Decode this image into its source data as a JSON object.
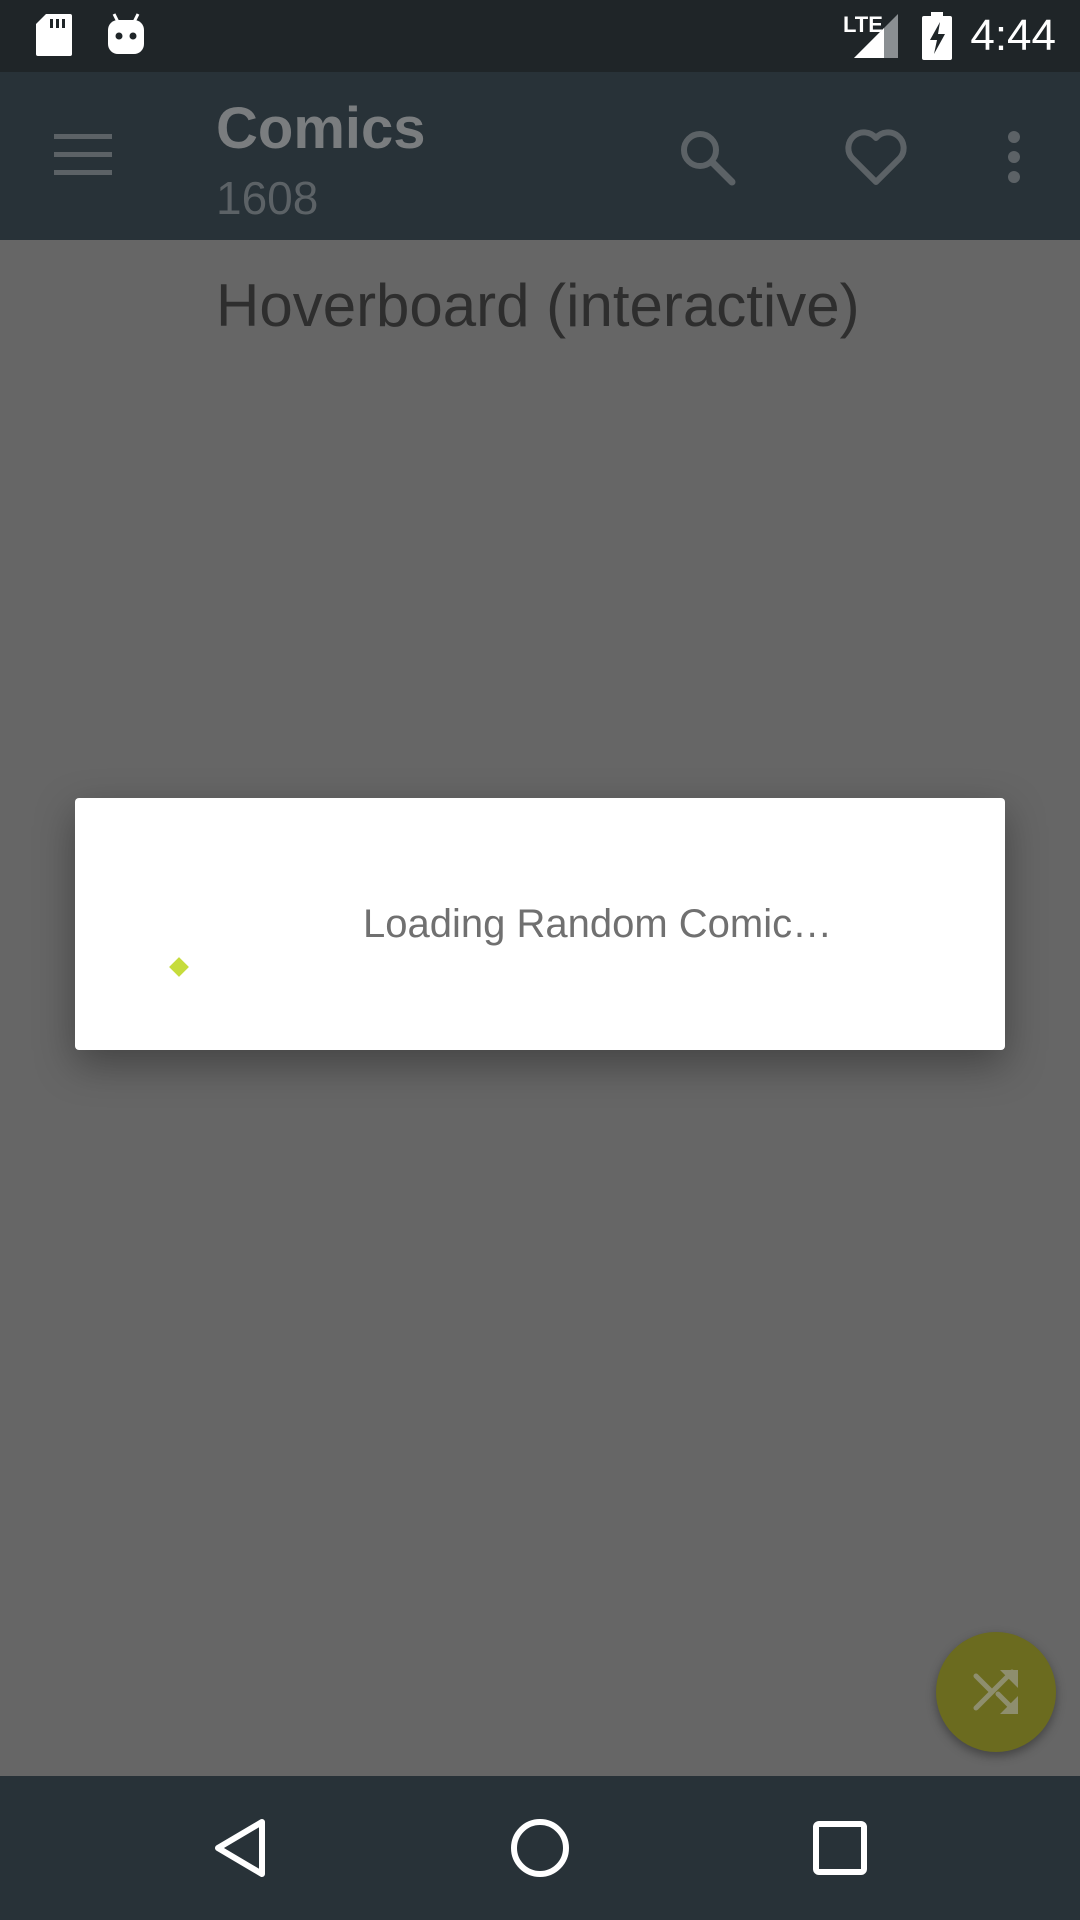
{
  "status_bar": {
    "time": "4:44",
    "network_label": "LTE",
    "icons": [
      "sd-card-icon",
      "android-debug-icon",
      "lte-signal-icon",
      "battery-charging-icon"
    ]
  },
  "toolbar": {
    "title": "Comics",
    "subtitle": "1608",
    "icons": [
      "menu-icon",
      "search-icon",
      "favorite-icon",
      "overflow-menu-icon"
    ]
  },
  "content": {
    "comic_title": "Hoverboard (interactive)"
  },
  "dialog": {
    "message": "Loading Random Comic…"
  },
  "fab": {
    "icon": "shuffle-icon"
  },
  "nav_bar": {
    "icons": [
      "back-icon",
      "home-icon",
      "recents-icon"
    ]
  },
  "colors": {
    "status_bar": "#1f2528",
    "toolbar": "#283238",
    "scrim_background": "#666666",
    "dialog": "#ffffff",
    "accent": "#c6dc3c",
    "fab_dimmed": "#6b6b1f"
  }
}
